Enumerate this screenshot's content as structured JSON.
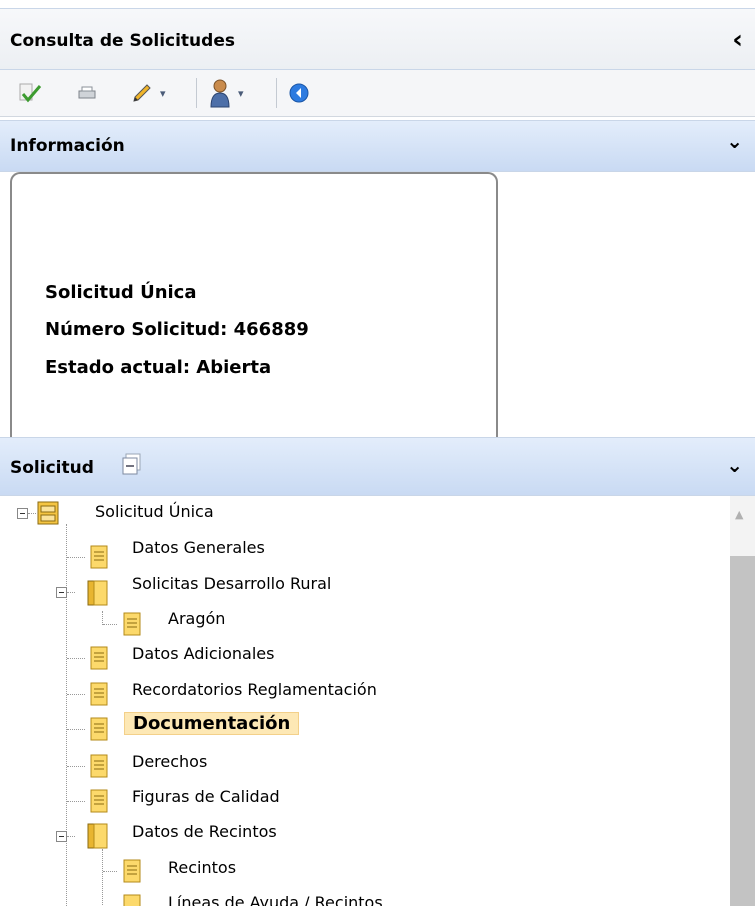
{
  "header": {
    "title": "Consulta de Solicitudes",
    "collapse_glyph": "‹"
  },
  "toolbar": {
    "items": [
      {
        "name": "validate-icon",
        "has_dropdown": false
      },
      {
        "name": "print-icon",
        "has_dropdown": false
      },
      {
        "name": "edit-pen-icon",
        "has_dropdown": true
      },
      {
        "name": "user-icon",
        "has_dropdown": true
      },
      {
        "name": "back-circle-icon",
        "has_dropdown": false
      }
    ],
    "dropdown_glyph": "▾"
  },
  "info_panel": {
    "title": "Información",
    "toggle_glyph": "⌄",
    "lines": [
      "Solicitud Única",
      "Número Solicitud: 466889",
      "Estado actual: Abierta"
    ]
  },
  "tree_panel": {
    "title": "Solicitud",
    "toggle_glyph": "⌄",
    "nodes": [
      {
        "label": "Solicitud Única",
        "icon": "cabinet-icon",
        "selected": false
      },
      {
        "label": "Datos Generales",
        "icon": "document-icon",
        "selected": false
      },
      {
        "label": "Solicitas Desarrollo Rural",
        "icon": "book-icon",
        "selected": false
      },
      {
        "label": "Aragón",
        "icon": "document-icon",
        "selected": false
      },
      {
        "label": "Datos Adicionales",
        "icon": "document-icon",
        "selected": false
      },
      {
        "label": "Recordatorios Reglamentación",
        "icon": "document-icon",
        "selected": false
      },
      {
        "label": "Documentación",
        "icon": "document-icon",
        "selected": true
      },
      {
        "label": "Derechos",
        "icon": "document-icon",
        "selected": false
      },
      {
        "label": "Figuras de Calidad",
        "icon": "document-icon",
        "selected": false
      },
      {
        "label": "Datos de Recintos",
        "icon": "book-icon",
        "selected": false
      },
      {
        "label": "Recintos",
        "icon": "document-icon",
        "selected": false
      },
      {
        "label": "Líneas de Ayuda / Recintos",
        "icon": "document-icon",
        "selected": false
      }
    ]
  },
  "colors": {
    "header_blue": "#c9daf3",
    "selection_bg": "#fde8b5",
    "doc_icon": "#f5c542"
  }
}
